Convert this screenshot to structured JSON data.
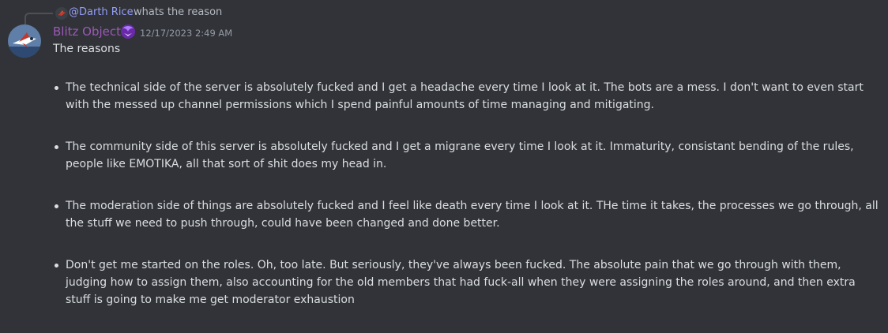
{
  "reply": {
    "username": "@Darth Rice",
    "text": "whats the reason"
  },
  "message": {
    "author": "Blitz Object",
    "timestamp": "12/17/2023 2:49 AM",
    "intro": "The reasons",
    "bullets": [
      "The technical side of the server is absolutely fucked and I get a headache every time I look at it. The bots are a mess. I don't want to even start with the messed up channel permissions which I spend painful amounts of time managing and mitigating.",
      "The community side of this server is absolutely fucked and I get a migrane every time I look at it. Immaturity, consistant bending of the rules, people like EMOTIKA, all that sort of shit does my head in.",
      "The moderation side of things are absolutely fucked and I feel like death every time I look at it. THe time it takes, the processes we go through, all the stuff we need to push through, could have been changed and done better.",
      "Don't get me started on the roles. Oh, too late. But seriously, they've always been fucked. The absolute pain that we go through with them, judging how to assign them, also accounting for the old members that had fuck-all when they were assigning the roles around, and then extra stuff is going to make me get moderator exhaustion"
    ]
  },
  "colors": {
    "background": "#313338",
    "author": "#9b59b6",
    "mention": "#949cf7",
    "text": "#dbdee1",
    "muted": "#949ba4"
  },
  "icons": {
    "reply_avatar": "reply-avatar-icon",
    "author_avatar": "author-avatar",
    "badge": "role-badge-icon"
  }
}
